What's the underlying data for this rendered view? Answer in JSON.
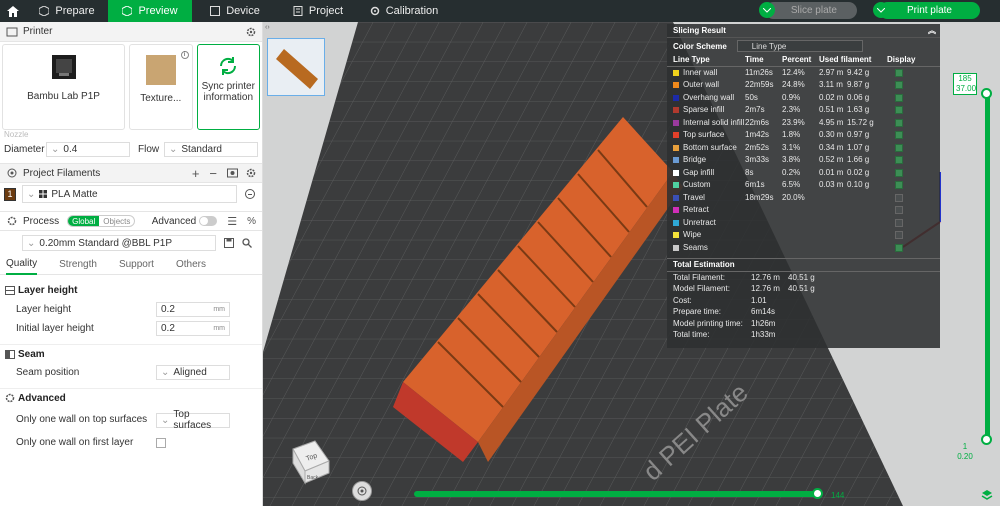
{
  "topbar": {
    "tabs": [
      {
        "label": "Prepare"
      },
      {
        "label": "Preview"
      },
      {
        "label": "Device"
      },
      {
        "label": "Project"
      },
      {
        "label": "Calibration"
      }
    ],
    "slice_label": "Slice plate",
    "print_label": "Print plate"
  },
  "printer": {
    "header": "Printer",
    "model": "Bambu Lab P1P",
    "plate": "Texture...",
    "sync": "Sync printer information",
    "nozzle_label": "Nozzle",
    "diameter_label": "Diameter",
    "diameter": "0.4",
    "flow_label": "Flow",
    "flow": "Standard"
  },
  "filaments": {
    "header": "Project Filaments",
    "items": [
      {
        "index": "1",
        "name": "PLA Matte",
        "color": "#6b3b10"
      }
    ]
  },
  "process": {
    "header": "Process",
    "global": "Global",
    "objects": "Objects",
    "advanced": "Advanced",
    "preset": "0.20mm Standard @BBL P1P",
    "tabs": [
      "Quality",
      "Strength",
      "Support",
      "Others"
    ],
    "groups": {
      "layer_height": "Layer height",
      "layer_height_label": "Layer height",
      "layer_height_value": "0.2",
      "initial_label": "Initial layer height",
      "initial_value": "0.2",
      "unit": "mm",
      "seam": "Seam",
      "seam_position_label": "Seam position",
      "seam_position": "Aligned",
      "advanced": "Advanced",
      "only_one_wall_label": "Only one wall on top surfaces",
      "only_one_wall": "Top surfaces",
      "first_layer_label": "Only one wall on first layer"
    }
  },
  "slicing": {
    "title": "Slicing Result",
    "color_scheme_label": "Color Scheme",
    "color_scheme": "Line Type",
    "columns": [
      "Line Type",
      "Time",
      "Percent",
      "Used filament",
      "Display"
    ],
    "rows": [
      {
        "name": "Inner wall",
        "color": "#f0d21c",
        "time": "11m26s",
        "percent": "12.4%",
        "len": "2.97 m",
        "wt": "9.42 g",
        "on": true
      },
      {
        "name": "Outer wall",
        "color": "#f08a1c",
        "time": "22m59s",
        "percent": "24.8%",
        "len": "3.11 m",
        "wt": "9.87 g",
        "on": true
      },
      {
        "name": "Overhang wall",
        "color": "#1c2aa8",
        "time": "50s",
        "percent": "0.9%",
        "len": "0.02 m",
        "wt": "0.06 g",
        "on": true
      },
      {
        "name": "Sparse infill",
        "color": "#b03a2e",
        "time": "2m7s",
        "percent": "2.3%",
        "len": "0.51 m",
        "wt": "1.63 g",
        "on": true
      },
      {
        "name": "Internal solid infill",
        "color": "#9b3a9e",
        "time": "22m6s",
        "percent": "23.9%",
        "len": "4.95 m",
        "wt": "15.72 g",
        "on": true
      },
      {
        "name": "Top surface",
        "color": "#e3402a",
        "time": "1m42s",
        "percent": "1.8%",
        "len": "0.30 m",
        "wt": "0.97 g",
        "on": true
      },
      {
        "name": "Bottom surface",
        "color": "#e8a03c",
        "time": "2m52s",
        "percent": "3.1%",
        "len": "0.34 m",
        "wt": "1.07 g",
        "on": true
      },
      {
        "name": "Bridge",
        "color": "#6a9bd4",
        "time": "3m33s",
        "percent": "3.8%",
        "len": "0.52 m",
        "wt": "1.66 g",
        "on": true
      },
      {
        "name": "Gap infill",
        "color": "#ffffff",
        "time": "8s",
        "percent": "0.2%",
        "len": "0.01 m",
        "wt": "0.02 g",
        "on": true
      },
      {
        "name": "Custom",
        "color": "#4fd0a0",
        "time": "6m1s",
        "percent": "6.5%",
        "len": "0.03 m",
        "wt": "0.10 g",
        "on": true
      },
      {
        "name": "Travel",
        "color": "#3b4fb5",
        "time": "18m29s",
        "percent": "20.0%",
        "len": "",
        "wt": "",
        "on": false
      },
      {
        "name": "Retract",
        "color": "#d02eb8",
        "time": "",
        "percent": "",
        "len": "",
        "wt": "",
        "on": false
      },
      {
        "name": "Unretract",
        "color": "#2fa8d6",
        "time": "",
        "percent": "",
        "len": "",
        "wt": "",
        "on": false
      },
      {
        "name": "Wipe",
        "color": "#f4e23a",
        "time": "",
        "percent": "",
        "len": "",
        "wt": "",
        "on": false
      },
      {
        "name": "Seams",
        "color": "#c8c8c8",
        "time": "",
        "percent": "",
        "len": "",
        "wt": "",
        "on": true
      }
    ],
    "total_header": "Total Estimation",
    "totals": [
      {
        "label": "Total Filament:",
        "a": "12.76 m",
        "b": "40.51 g"
      },
      {
        "label": "Model Filament:",
        "a": "12.76 m",
        "b": "40.51 g"
      },
      {
        "label": "Cost:",
        "a": "1.01",
        "b": ""
      },
      {
        "label": "Prepare time:",
        "a": "6m14s",
        "b": ""
      },
      {
        "label": "Model printing time:",
        "a": "1h26m",
        "b": ""
      },
      {
        "label": "Total time:",
        "a": "1h33m",
        "b": ""
      }
    ]
  },
  "slider": {
    "v_top_a": "185",
    "v_top_b": "37.00",
    "v_bot_a": "1",
    "v_bot_b": "0.20",
    "h_value": "144"
  },
  "scene": {
    "plate_text": "d PEI Plate",
    "cube_top": "Top",
    "cube_front": "Back"
  }
}
